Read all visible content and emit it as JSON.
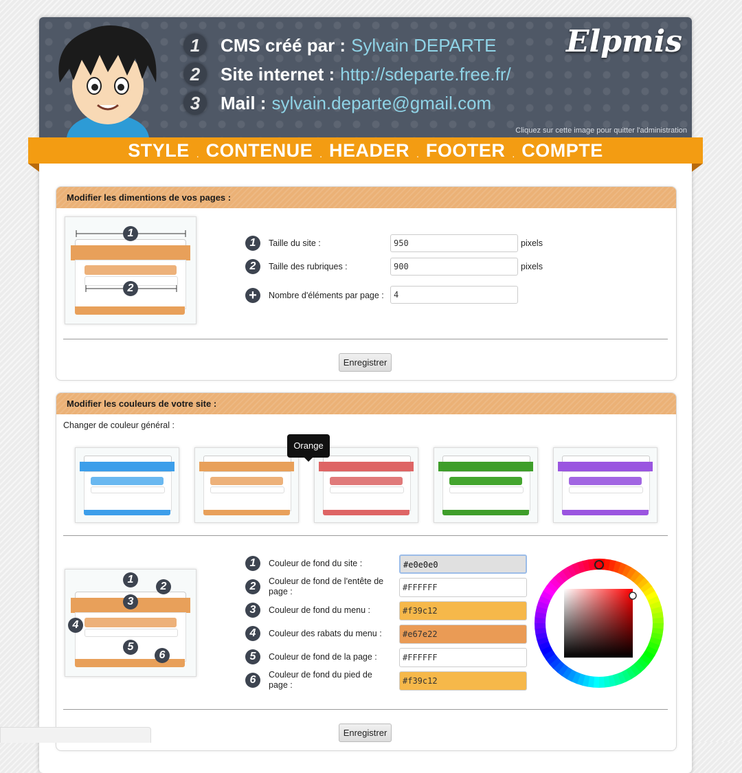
{
  "header": {
    "lines": [
      {
        "num": "1",
        "label": "CMS créé par :",
        "value": "Sylvain DEPARTE"
      },
      {
        "num": "2",
        "label": "Site internet :",
        "value": "http://sdeparte.free.fr/"
      },
      {
        "num": "3",
        "label": "Mail :",
        "value": "sylvain.departe@gmail.com"
      }
    ],
    "logo": "Elpmis",
    "hint": "Cliquez sur cette image pour quitter l'administration"
  },
  "menu": {
    "items": [
      "STYLE",
      "CONTENUE",
      "HEADER",
      "FOOTER",
      "COMPTE"
    ],
    "separator": "."
  },
  "dimensions": {
    "title": "Modifier les dimentions de vos pages :",
    "fields": [
      {
        "icon": "1",
        "label": "Taille du site :",
        "value": "950",
        "unit": "pixels"
      },
      {
        "icon": "2",
        "label": "Taille des rubriques :",
        "value": "900",
        "unit": "pixels"
      },
      {
        "icon": "+",
        "label": "Nombre d'éléments par page :",
        "value": "4",
        "unit": ""
      }
    ],
    "save": "Enregistrer"
  },
  "colors": {
    "title": "Modifier les couleurs de votre site :",
    "general_label": "Changer de couleur général :",
    "tooltip": "Orange",
    "themes": [
      {
        "name": "blue",
        "main": "#3c9eea",
        "light": "#6ab8f0"
      },
      {
        "name": "orange",
        "main": "#e8a05a",
        "light": "#edb17a"
      },
      {
        "name": "red",
        "main": "#de6565",
        "light": "#e07a7a"
      },
      {
        "name": "green",
        "main": "#3e9e2a",
        "light": "#44a52e"
      },
      {
        "name": "purple",
        "main": "#9a55e0",
        "light": "#a266e2"
      }
    ],
    "fields": [
      {
        "icon": "1",
        "label": "Couleur de fond du site :",
        "value": "#e0e0e0",
        "bg": "#e0e0e0"
      },
      {
        "icon": "2",
        "label": "Couleur de fond de l'entête de page :",
        "value": "#FFFFFF",
        "bg": "#ffffff"
      },
      {
        "icon": "3",
        "label": "Couleur de fond du menu :",
        "value": "#f39c12",
        "bg": "#f6b84a"
      },
      {
        "icon": "4",
        "label": "Couleur des rabats du menu :",
        "value": "#e67e22",
        "bg": "#ea9b55"
      },
      {
        "icon": "5",
        "label": "Couleur de fond de la page :",
        "value": "#FFFFFF",
        "bg": "#ffffff"
      },
      {
        "icon": "6",
        "label": "Couleur de fond du pied de page :",
        "value": "#f39c12",
        "bg": "#f6b84a"
      }
    ],
    "save": "Enregistrer"
  }
}
